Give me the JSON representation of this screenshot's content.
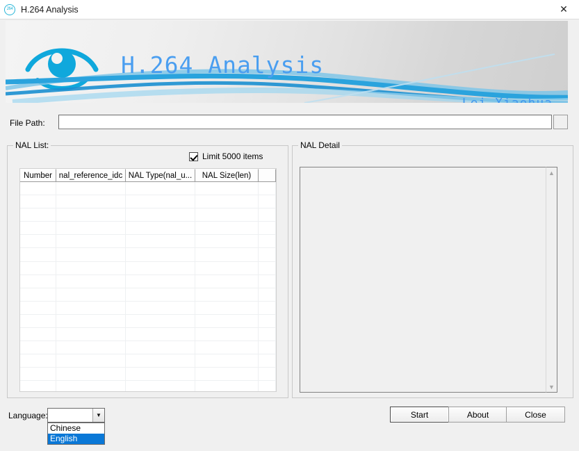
{
  "window": {
    "title": "H.264 Analysis",
    "icon_label": "264",
    "close_label": "✕"
  },
  "banner": {
    "title": "H.264 Analysis",
    "author": "Lei Xiaohua",
    "logo_icon": "eye-icon",
    "accent_color": "#4a9ef0",
    "logo_color": "#0fa8dc"
  },
  "file_path": {
    "label": "File Path:",
    "value": "",
    "placeholder": "",
    "browse_label": ""
  },
  "nal_list": {
    "group_title": "NAL List:",
    "limit_checkbox": {
      "label": "Limit 5000 items",
      "checked": true
    },
    "columns": [
      "Number",
      "nal_reference_idc",
      "NAL Type(nal_u...",
      "NAL Size(len)",
      ""
    ],
    "rows": [],
    "row_count": 16
  },
  "nal_detail": {
    "group_title": "NAL Detail",
    "content": "",
    "scroll_up": "▲",
    "scroll_down": "▼"
  },
  "bottom": {
    "language_label": "Language:",
    "language_value": "",
    "language_options": [
      {
        "label": "Chinese",
        "selected": false
      },
      {
        "label": "English",
        "selected": true
      }
    ],
    "highlight_color": "#0a78d7",
    "buttons": {
      "start": "Start",
      "about": "About",
      "close": "Close"
    }
  }
}
